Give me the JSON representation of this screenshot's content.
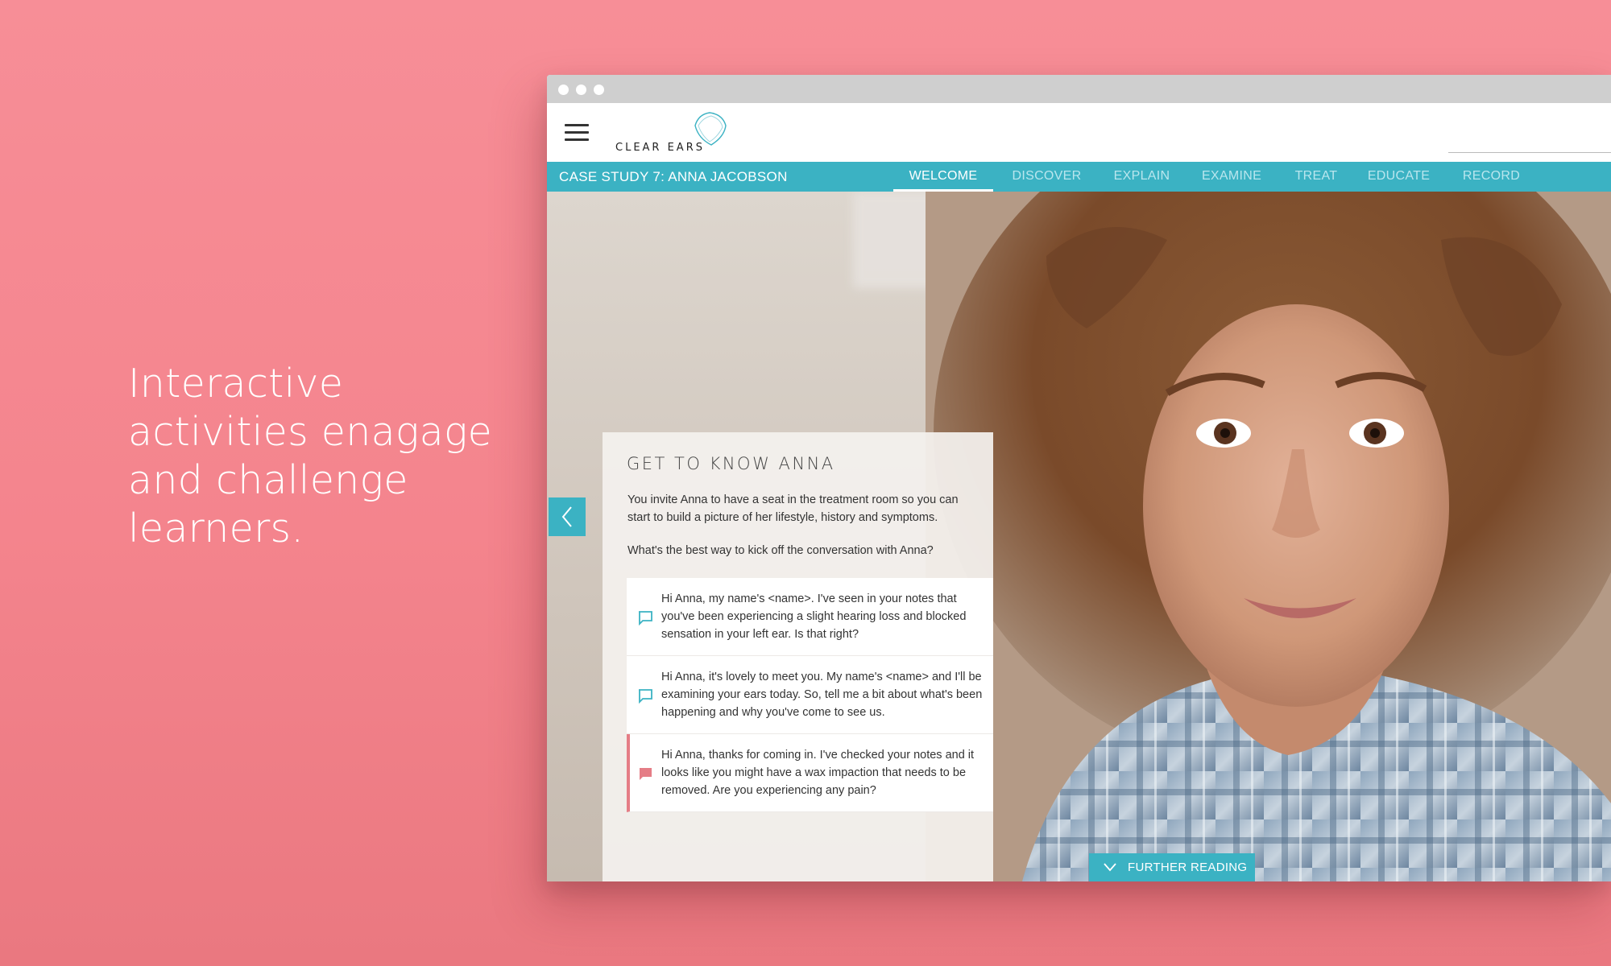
{
  "tagline": "Interactive activities enagage and challenge learners.",
  "colors": {
    "background": "#f78e97",
    "accent": "#3bb2c3",
    "incorrect": "#e57d86"
  },
  "browser": {
    "traffic_lights": [
      "dot",
      "dot",
      "dot"
    ]
  },
  "header": {
    "menu_icon": "hamburger-icon",
    "logo_text": "CLEAR EARS",
    "logo_icon": "diamond-logo-icon"
  },
  "nav": {
    "case_title": "CASE STUDY 7: ANNA JACOBSON",
    "tabs": [
      {
        "label": "WELCOME",
        "active": true
      },
      {
        "label": "DISCOVER",
        "active": false
      },
      {
        "label": "EXPLAIN",
        "active": false
      },
      {
        "label": "EXAMINE",
        "active": false
      },
      {
        "label": "TREAT",
        "active": false
      },
      {
        "label": "EDUCATE",
        "active": false
      },
      {
        "label": "RECORD",
        "active": false
      }
    ]
  },
  "panel": {
    "title": "GET TO KNOW ANNA",
    "intro": "You invite Anna to have a seat in the treatment room so you can start to build a picture of her lifestyle, history and symptoms.",
    "question": "What's the best way to kick off the conversation with Anna?",
    "options": [
      {
        "text": "Hi Anna, my name's <name>. I've seen in your notes that you've been experiencing a slight hearing loss and blocked sensation in your left ear. Is that right?",
        "state": "default",
        "icon": "speech-bubble-icon"
      },
      {
        "text": "Hi Anna, it's lovely to meet you. My name's <name> and I'll be examining your ears today. So, tell me a bit about what's been happening and why you've come to see us.",
        "state": "default",
        "icon": "speech-bubble-icon"
      },
      {
        "text": "Hi Anna, thanks for coming in. I've checked your notes and it looks like you might have a wax impaction that needs to be removed. Are you experiencing any pain?",
        "state": "incorrect",
        "icon": "speech-bubble-filled-icon"
      }
    ]
  },
  "prev_icon": "chevron-left-icon",
  "further_reading": {
    "label": "FURTHER READING",
    "icon": "chevron-down-icon"
  }
}
